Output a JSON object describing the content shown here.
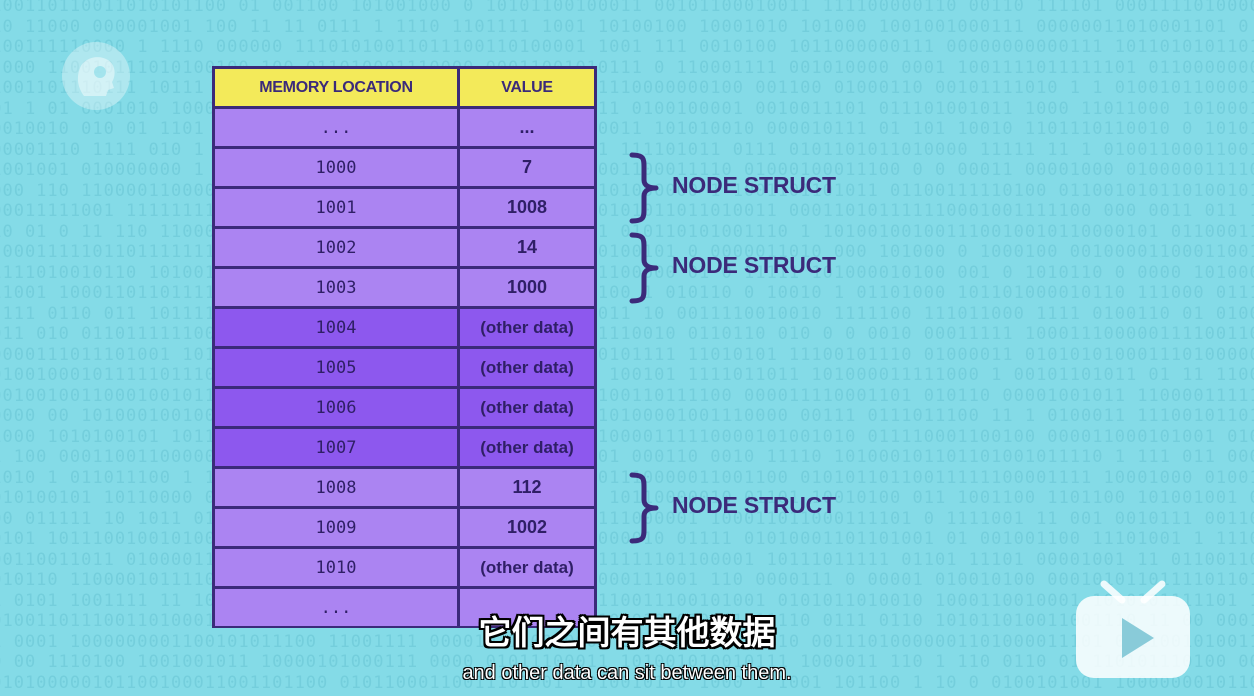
{
  "table": {
    "headers": [
      "MEMORY LOCATION",
      "VALUE"
    ],
    "rows": [
      {
        "location": "...",
        "value": "...",
        "shade": "light"
      },
      {
        "location": "1000",
        "value": "7",
        "shade": "light"
      },
      {
        "location": "1001",
        "value": "1008",
        "shade": "light"
      },
      {
        "location": "1002",
        "value": "14",
        "shade": "light"
      },
      {
        "location": "1003",
        "value": "1000",
        "shade": "light"
      },
      {
        "location": "1004",
        "value": "(other data)",
        "shade": "dark"
      },
      {
        "location": "1005",
        "value": "(other data)",
        "shade": "dark"
      },
      {
        "location": "1006",
        "value": "(other data)",
        "shade": "dark"
      },
      {
        "location": "1007",
        "value": "(other data)",
        "shade": "dark"
      },
      {
        "location": "1008",
        "value": "112",
        "shade": "light"
      },
      {
        "location": "1009",
        "value": "1002",
        "shade": "light"
      },
      {
        "location": "1010",
        "value": "(other data)",
        "shade": "light"
      },
      {
        "location": "...",
        "value": "",
        "shade": "light"
      }
    ]
  },
  "annotations": [
    {
      "label": "NODE STRUCT",
      "rows": [
        "1000",
        "1001"
      ]
    },
    {
      "label": "NODE STRUCT",
      "rows": [
        "1002",
        "1003"
      ]
    },
    {
      "label": "NODE STRUCT",
      "rows": [
        "1008",
        "1009"
      ]
    }
  ],
  "subtitles": {
    "chinese": "它们之间有其他数据",
    "english": "and other data can sit between them."
  },
  "logos": {
    "top_left": "crash-course-head-icon",
    "bottom_right": "bilibili-tv-play-icon"
  },
  "colors": {
    "background": "#84dbe7",
    "header_fill": "#f3ea5a",
    "row_light": "#ab84f2",
    "row_dark": "#8d58ee",
    "ink": "#3b2a7a"
  }
}
